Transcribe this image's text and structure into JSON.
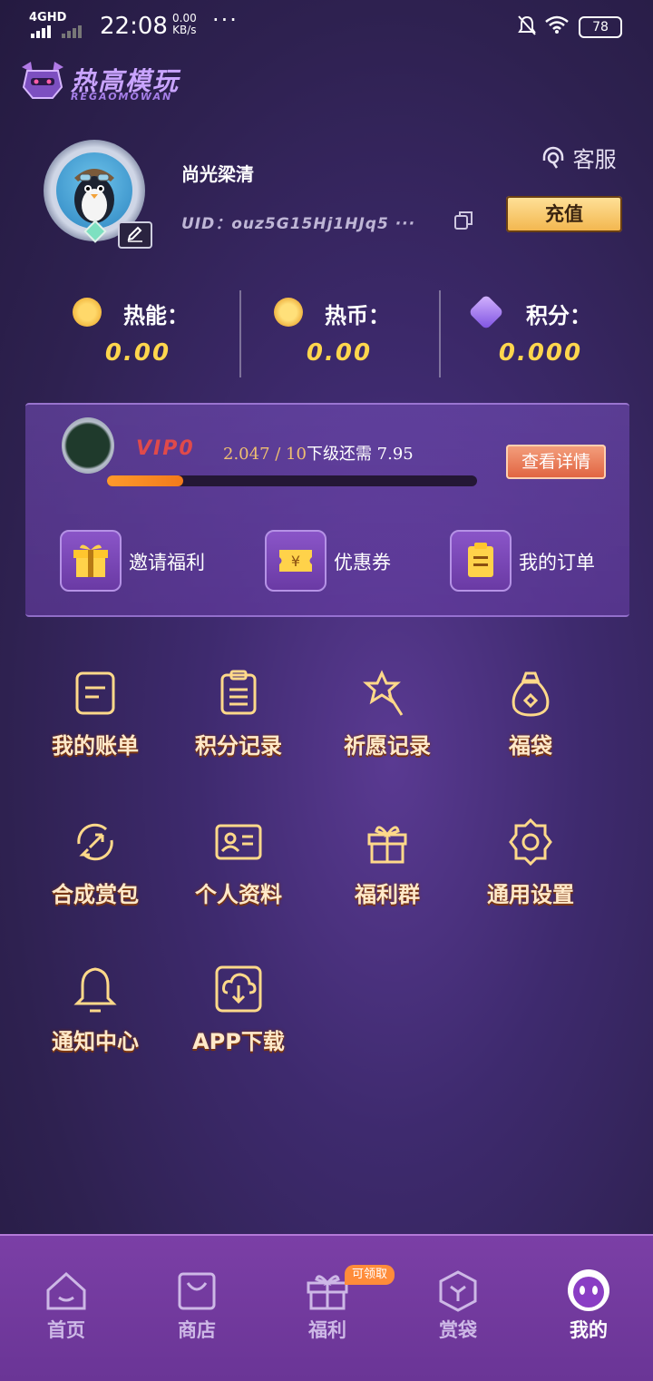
{
  "status_bar": {
    "network": "4GHD",
    "time": "22:08",
    "speed_value": "0.00",
    "speed_unit": "KB/s",
    "battery": "78"
  },
  "app": {
    "logo_title": "热高模玩",
    "logo_subtitle": "REGAOMOWAN"
  },
  "profile": {
    "username": "尚光梁清",
    "uid": "UID：ouz5G15Hj1HJq5 ···",
    "service_label": "客服",
    "recharge_label": "充值"
  },
  "balances": [
    {
      "label": "热能：",
      "value": "0.00",
      "icon": "energy-coin-icon",
      "color": "#f5b630"
    },
    {
      "label": "热币：",
      "value": "0.00",
      "icon": "hot-coin-icon",
      "color": "#f5a020"
    },
    {
      "label": "积分：",
      "value": "0.000",
      "icon": "points-gem-icon",
      "color": "#9a6cf0"
    }
  ],
  "vip": {
    "level": "VIP0",
    "current": "2.047",
    "separator": " / ",
    "target": "10",
    "remaining_text": "下级还需 7.95",
    "progress": 0.205,
    "detail_label": "查看详情"
  },
  "quick_actions": [
    {
      "label": "邀请福利",
      "icon": "gift-icon"
    },
    {
      "label": "优惠券",
      "icon": "coupon-icon"
    },
    {
      "label": "我的订单",
      "icon": "order-icon"
    }
  ],
  "menu": [
    {
      "label": "我的账单",
      "icon": "bill-icon"
    },
    {
      "label": "积分记录",
      "icon": "points-record-icon"
    },
    {
      "label": "祈愿记录",
      "icon": "wish-wand-icon"
    },
    {
      "label": "福袋",
      "icon": "lucky-bag-icon"
    },
    {
      "label": "合成赏包",
      "icon": "synthesis-icon"
    },
    {
      "label": "个人资料",
      "icon": "profile-card-icon"
    },
    {
      "label": "福利群",
      "icon": "gift-group-icon"
    },
    {
      "label": "通用设置",
      "icon": "settings-gear-icon"
    },
    {
      "label": "通知中心",
      "icon": "bell-icon"
    },
    {
      "label": "APP下载",
      "icon": "app-download-icon"
    }
  ],
  "tabs": [
    {
      "label": "首页",
      "icon": "home-icon"
    },
    {
      "label": "商店",
      "icon": "shop-bag-icon"
    },
    {
      "label": "福利",
      "icon": "gift-tab-icon",
      "tag": "可领取"
    },
    {
      "label": "赏袋",
      "icon": "prize-box-icon"
    },
    {
      "label": "我的",
      "icon": "mine-avatar-icon",
      "active": true
    }
  ],
  "colors": {
    "accent_gold": "#ffd64d",
    "tab_bar": "#6a3596",
    "vip_progress": "#ff9a2b"
  }
}
